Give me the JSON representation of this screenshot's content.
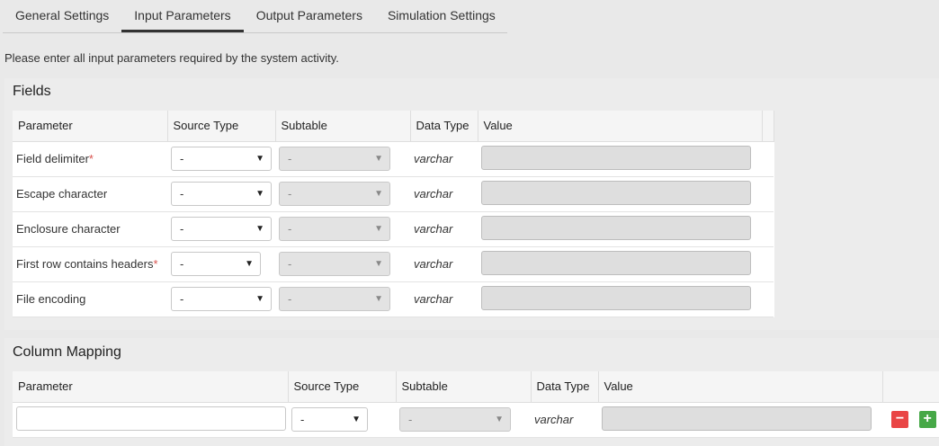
{
  "tabs": [
    "General Settings",
    "Input Parameters",
    "Output Parameters",
    "Simulation Settings"
  ],
  "active_tab": "Input Parameters",
  "intro": "Please enter all input parameters required by the system activity.",
  "fields": {
    "title": "Fields",
    "headers": [
      "Parameter",
      "Source Type",
      "Subtable",
      "Data Type",
      "Value"
    ],
    "rows": [
      {
        "name": "Field delimiter",
        "required": "*",
        "source": "-",
        "subtable": "-",
        "dtype": "varchar"
      },
      {
        "name": "Escape character",
        "required": "",
        "source": "-",
        "subtable": "-",
        "dtype": "varchar"
      },
      {
        "name": "Enclosure character",
        "required": "",
        "source": "-",
        "subtable": "-",
        "dtype": "varchar"
      },
      {
        "name": "First row contains headers",
        "required": "*",
        "source": "-",
        "subtable": "-",
        "dtype": "varchar"
      },
      {
        "name": "File encoding",
        "required": "",
        "source": "-",
        "subtable": "-",
        "dtype": "varchar"
      }
    ]
  },
  "mapping": {
    "title": "Column Mapping",
    "headers": [
      "Parameter",
      "Source Type",
      "Subtable",
      "Data Type",
      "Value"
    ],
    "row": {
      "source": "-",
      "subtable": "-",
      "dtype": "varchar"
    },
    "remove_icon": "−",
    "add_icon": "+"
  },
  "colors": {
    "required": "#d9534f",
    "remove": "#e94545",
    "add": "#46a847"
  }
}
